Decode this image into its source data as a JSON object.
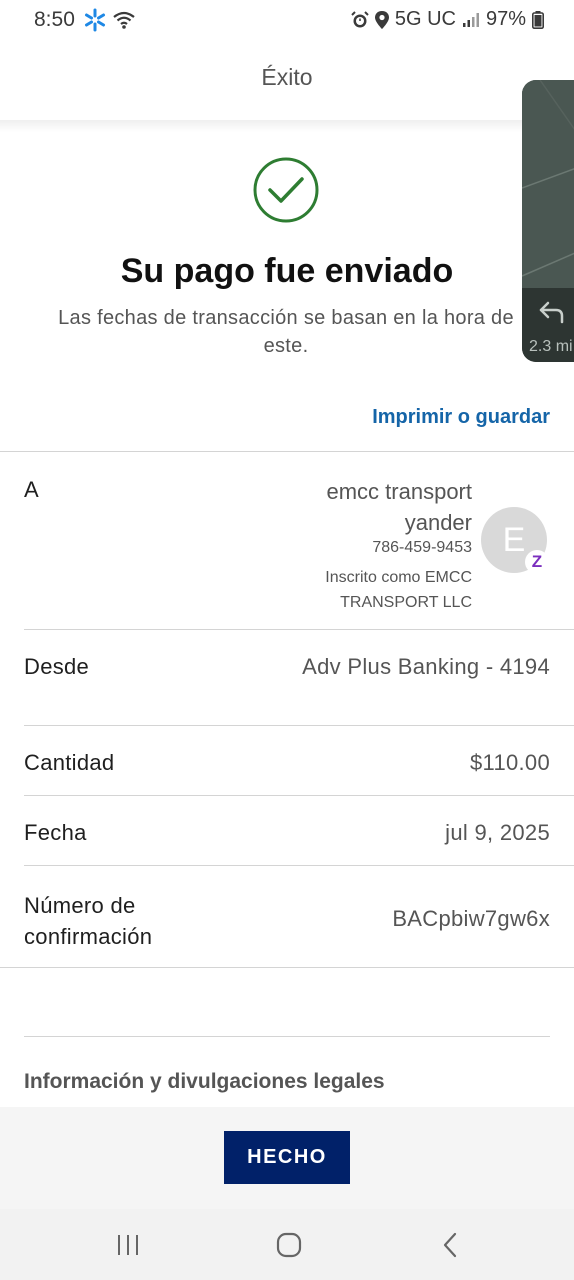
{
  "status_bar": {
    "time": "8:50",
    "network": "5G UC",
    "battery": "97%",
    "icons": [
      "walmart-spark-icon",
      "wifi-icon",
      "alarm-icon",
      "location-icon",
      "signal-icon",
      "battery-icon"
    ]
  },
  "header": {
    "title": "Éxito"
  },
  "success": {
    "title": "Su pago fue enviado",
    "subtitle": "Las fechas de transacción se basan en la hora de este.",
    "check_color": "#2e7d32"
  },
  "floating_widget": {
    "distance": "2.3 mi"
  },
  "print_link": "Imprimir o guardar",
  "details": {
    "to": {
      "label": "A",
      "name": "emcc transport yander",
      "phone": "786-459-9453",
      "enrolled": "Inscrito como EMCC TRANSPORT LLC",
      "avatar_letter": "E",
      "badge": "Z"
    },
    "from": {
      "label": "Desde",
      "value": "Adv Plus Banking - 4194"
    },
    "amount": {
      "label": "Cantidad",
      "value": "$110.00"
    },
    "date": {
      "label": "Fecha",
      "value": "jul 9, 2025"
    },
    "confirmation": {
      "label": "Número de confirmación",
      "value": "BACpbiw7gw6x"
    }
  },
  "legal": "Información y divulgaciones legales",
  "done_button": "HECHO",
  "colors": {
    "accent_link": "#1565a8",
    "button": "#012169",
    "zelle": "#7b2fbe"
  }
}
